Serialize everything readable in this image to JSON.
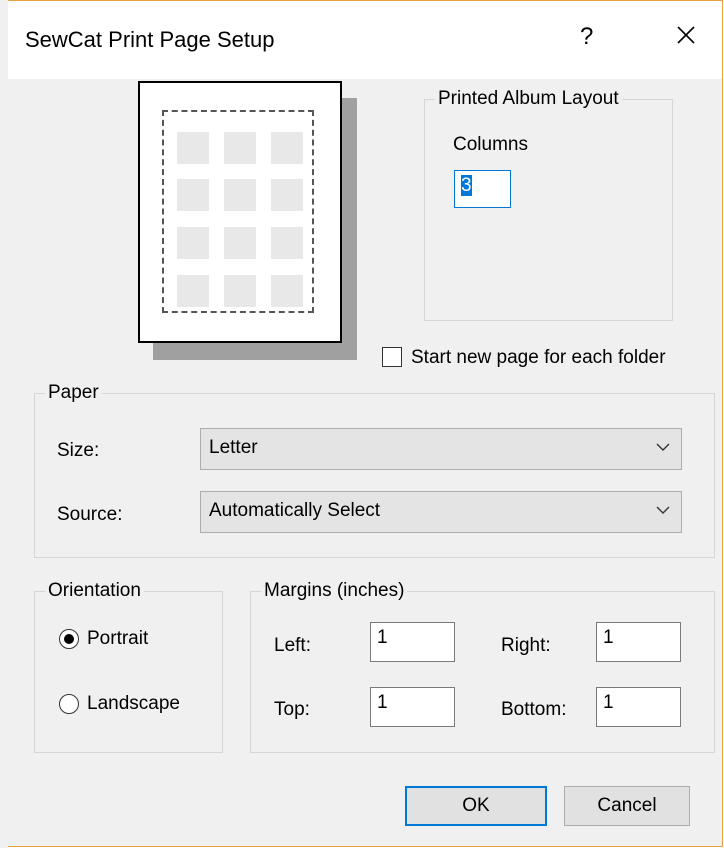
{
  "window": {
    "title": "SewCat Print Page Setup",
    "help_label": "?",
    "close_icon": "close-icon",
    "accent_border": "#e8a040"
  },
  "album_layout": {
    "legend": "Printed Album Layout",
    "columns_label": "Columns",
    "columns_value": "3"
  },
  "new_page_checkbox": {
    "label": "Start new page for each folder",
    "checked": false
  },
  "paper": {
    "legend": "Paper",
    "size_label": "Size:",
    "size_value": "Letter",
    "source_label": "Source:",
    "source_value": "Automatically Select"
  },
  "orientation": {
    "legend": "Orientation",
    "portrait_label": "Portrait",
    "landscape_label": "Landscape",
    "selected": "Portrait"
  },
  "margins": {
    "legend": "Margins (inches)",
    "left_label": "Left:",
    "left_value": "1",
    "right_label": "Right:",
    "right_value": "1",
    "top_label": "Top:",
    "top_value": "1",
    "bottom_label": "Bottom:",
    "bottom_value": "1"
  },
  "buttons": {
    "ok_label": "OK",
    "cancel_label": "Cancel"
  },
  "colors": {
    "dialog_bg": "#f0f0f0",
    "focus_blue": "#0078d7"
  }
}
